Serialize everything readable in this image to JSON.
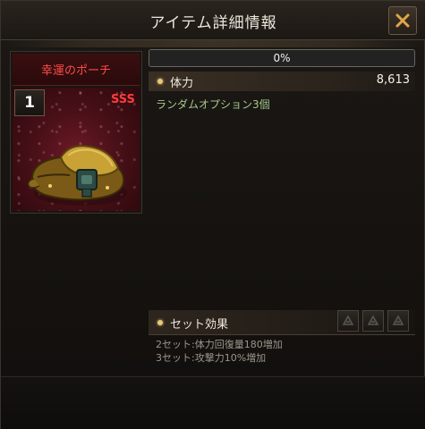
{
  "window": {
    "title": "アイテム詳細情報"
  },
  "item": {
    "name": "幸運のポーチ",
    "level": "1",
    "grade": "SSS",
    "icon": "pouch-icon",
    "name_color": "#ff4a4a"
  },
  "progress": {
    "label": "0%",
    "value": 0
  },
  "stats": {
    "label": "体力",
    "value": "8,613"
  },
  "random_option": "ランダムオプション3個",
  "set": {
    "title": "セット効果",
    "effects": [
      "2セット:体力回復量180増加",
      "3セット:攻撃力10%増加"
    ],
    "icons": [
      "set-piece-icon",
      "set-piece-icon",
      "set-piece-icon"
    ]
  },
  "colors": {
    "accent_gold": "#e8c878",
    "option_green": "#a6c98a"
  }
}
